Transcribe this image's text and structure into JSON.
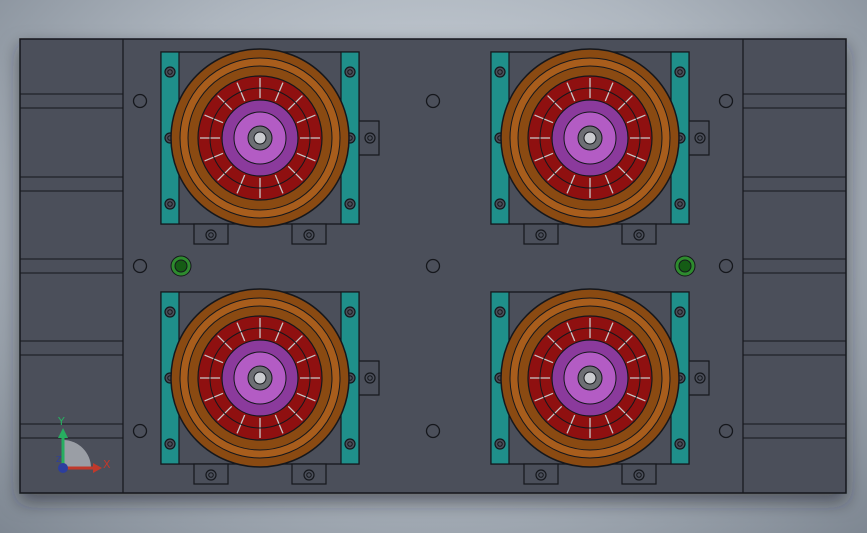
{
  "viewport": {
    "background_top": "#d7dde4",
    "background_bottom": "#7e8792"
  },
  "triad": {
    "x_label": "X",
    "y_label": "Y",
    "z_label": "Z",
    "x_color": "#c0392b",
    "y_color": "#27ae60",
    "z_color": "#2c3e9e"
  },
  "model": {
    "plate_color": "#4b4f5a",
    "edge_color": "#15171c",
    "rail_color": "#1f8f8a",
    "wheel_outer_color": "#8a4a12",
    "wheel_mid_color": "#a85d1c",
    "rotor_color": "#8f1010",
    "hub_color": "#8b3a9c",
    "hub_light_color": "#b35cc4",
    "dowel_color": "#2e8b2e",
    "motor_count": 4
  }
}
